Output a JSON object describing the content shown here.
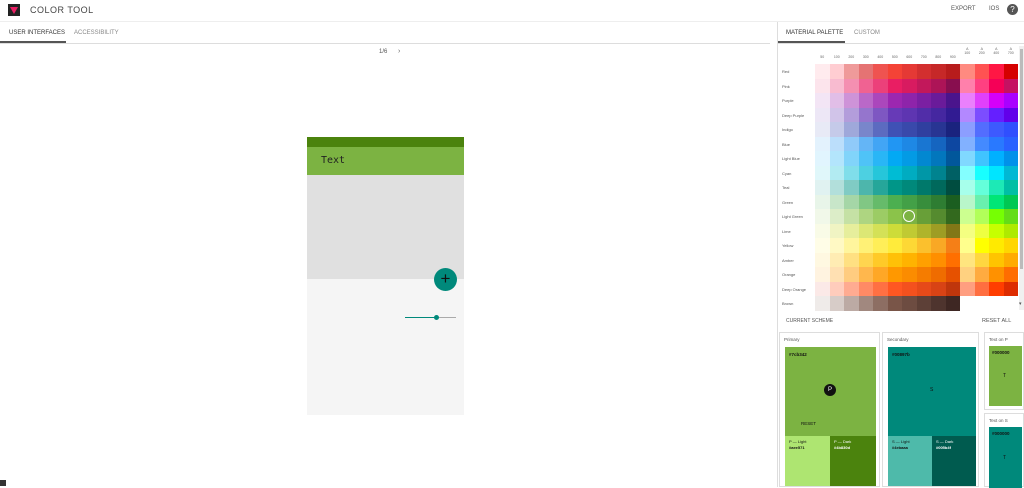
{
  "app": {
    "title": "COLOR  TOOL"
  },
  "top_actions": {
    "export": "EXPORT",
    "ios": "IOS",
    "help": "?"
  },
  "left_tabs": [
    {
      "label": "USER INTERFACES",
      "active": true
    },
    {
      "label": "ACCESSIBILITY",
      "active": false
    }
  ],
  "pager": {
    "position": "1/6",
    "next": "›"
  },
  "phone": {
    "appbar_text": "Text",
    "fab_symbol": "+",
    "slider_value": 0.6,
    "colors": {
      "primary_dark": "#4b830d",
      "primary": "#7cb342",
      "secondary": "#00897b"
    }
  },
  "right_tabs": [
    {
      "label": "MATERIAL PALETTE",
      "active": true
    },
    {
      "label": "CUSTOM",
      "active": false
    }
  ],
  "palette": {
    "shades": [
      "50",
      "100",
      "200",
      "300",
      "400",
      "500",
      "600",
      "700",
      "800",
      "900",
      "A\n100",
      "A\n200",
      "A\n400",
      "A\n700"
    ],
    "rows": [
      {
        "name": "Red",
        "colors": [
          "#ffebee",
          "#ffcdd2",
          "#ef9a9a",
          "#e57373",
          "#ef5350",
          "#f44336",
          "#e53935",
          "#d32f2f",
          "#c62828",
          "#b71c1c",
          "#ff8a80",
          "#ff5252",
          "#ff1744",
          "#d50000"
        ]
      },
      {
        "name": "Pink",
        "colors": [
          "#fce4ec",
          "#f8bbd0",
          "#f48fb1",
          "#f06292",
          "#ec407a",
          "#e91e63",
          "#d81b60",
          "#c2185b",
          "#ad1457",
          "#880e4f",
          "#ff80ab",
          "#ff4081",
          "#f50057",
          "#c51162"
        ]
      },
      {
        "name": "Purple",
        "colors": [
          "#f3e5f5",
          "#e1bee7",
          "#ce93d8",
          "#ba68c8",
          "#ab47bc",
          "#9c27b0",
          "#8e24aa",
          "#7b1fa2",
          "#6a1b9a",
          "#4a148c",
          "#ea80fc",
          "#e040fb",
          "#d500f9",
          "#aa00ff"
        ]
      },
      {
        "name": "Deep Purple",
        "colors": [
          "#ede7f6",
          "#d1c4e9",
          "#b39ddb",
          "#9575cd",
          "#7e57c2",
          "#673ab7",
          "#5e35b1",
          "#512da8",
          "#4527a0",
          "#311b92",
          "#b388ff",
          "#7c4dff",
          "#651fff",
          "#6200ea"
        ]
      },
      {
        "name": "Indigo",
        "colors": [
          "#e8eaf6",
          "#c5cae9",
          "#9fa8da",
          "#7986cb",
          "#5c6bc0",
          "#3f51b5",
          "#3949ab",
          "#303f9f",
          "#283593",
          "#1a237e",
          "#8c9eff",
          "#536dfe",
          "#3d5afe",
          "#304ffe"
        ]
      },
      {
        "name": "Blue",
        "colors": [
          "#e3f2fd",
          "#bbdefb",
          "#90caf9",
          "#64b5f6",
          "#42a5f5",
          "#2196f3",
          "#1e88e5",
          "#1976d2",
          "#1565c0",
          "#0d47a1",
          "#82b1ff",
          "#448aff",
          "#2979ff",
          "#2962ff"
        ]
      },
      {
        "name": "Light Blue",
        "colors": [
          "#e1f5fe",
          "#b3e5fc",
          "#81d4fa",
          "#4fc3f7",
          "#29b6f6",
          "#03a9f4",
          "#039be5",
          "#0288d1",
          "#0277bd",
          "#01579b",
          "#80d8ff",
          "#40c4ff",
          "#00b0ff",
          "#0091ea"
        ]
      },
      {
        "name": "Cyan",
        "colors": [
          "#e0f7fa",
          "#b2ebf2",
          "#80deea",
          "#4dd0e1",
          "#26c6da",
          "#00bcd4",
          "#00acc1",
          "#0097a7",
          "#00838f",
          "#006064",
          "#84ffff",
          "#18ffff",
          "#00e5ff",
          "#00b8d4"
        ]
      },
      {
        "name": "Teal",
        "colors": [
          "#e0f2f1",
          "#b2dfdb",
          "#80cbc4",
          "#4db6ac",
          "#26a69a",
          "#009688",
          "#00897b",
          "#00796b",
          "#00695c",
          "#004d40",
          "#a7ffeb",
          "#64ffda",
          "#1de9b6",
          "#00bfa5"
        ]
      },
      {
        "name": "Green",
        "colors": [
          "#e8f5e9",
          "#c8e6c9",
          "#a5d6a7",
          "#81c784",
          "#66bb6a",
          "#4caf50",
          "#43a047",
          "#388e3c",
          "#2e7d32",
          "#1b5e20",
          "#b9f6ca",
          "#69f0ae",
          "#00e676",
          "#00c853"
        ]
      },
      {
        "name": "Light Green",
        "colors": [
          "#f1f8e9",
          "#dcedc8",
          "#c5e1a5",
          "#aed581",
          "#9ccc65",
          "#8bc34a",
          "#7cb342",
          "#689f38",
          "#558b2f",
          "#33691e",
          "#ccff90",
          "#b2ff59",
          "#76ff03",
          "#64dd17"
        ]
      },
      {
        "name": "Lime",
        "colors": [
          "#f9fbe7",
          "#f0f4c3",
          "#e6ee9c",
          "#dce775",
          "#d4e157",
          "#cddc39",
          "#c0ca33",
          "#afb42b",
          "#9e9d24",
          "#827717",
          "#f4ff81",
          "#eeff41",
          "#c6ff00",
          "#aeea00"
        ]
      },
      {
        "name": "Yellow",
        "colors": [
          "#fffde7",
          "#fff9c4",
          "#fff59d",
          "#fff176",
          "#ffee58",
          "#ffeb3b",
          "#fdd835",
          "#fbc02d",
          "#f9a825",
          "#f57f17",
          "#ffff8d",
          "#ffff00",
          "#ffea00",
          "#ffd600"
        ]
      },
      {
        "name": "Amber",
        "colors": [
          "#fff8e1",
          "#ffecb3",
          "#ffe082",
          "#ffd54f",
          "#ffca28",
          "#ffc107",
          "#ffb300",
          "#ffa000",
          "#ff8f00",
          "#ff6f00",
          "#ffe57f",
          "#ffd740",
          "#ffc400",
          "#ffab00"
        ]
      },
      {
        "name": "Orange",
        "colors": [
          "#fff3e0",
          "#ffe0b2",
          "#ffcc80",
          "#ffb74d",
          "#ffa726",
          "#ff9800",
          "#fb8c00",
          "#f57c00",
          "#ef6c00",
          "#e65100",
          "#ffd180",
          "#ffab40",
          "#ff9100",
          "#ff6d00"
        ]
      },
      {
        "name": "Deep Orange",
        "colors": [
          "#fbe9e7",
          "#ffccbc",
          "#ffab91",
          "#ff8a65",
          "#ff7043",
          "#ff5722",
          "#f4511e",
          "#e64a19",
          "#d84315",
          "#bf360c",
          "#ff9e80",
          "#ff6e40",
          "#ff3d00",
          "#dd2c00"
        ]
      },
      {
        "name": "Brown",
        "colors": [
          "#efebe9",
          "#d7ccc8",
          "#bcaaa4",
          "#a1887f",
          "#8d6e63",
          "#795548",
          "#6d4c41",
          "#5d4037",
          "#4e342e",
          "#3e2723",
          "",
          "",
          "",
          ""
        ]
      }
    ]
  },
  "scheme": {
    "title": "CURRENT SCHEME",
    "reset_all": "RESET ALL",
    "primary": {
      "label": "Primary",
      "hex": "#7cb342",
      "letter": "P",
      "reset": "RESET",
      "light_label": "P — Light",
      "light_hex": "#aee571",
      "dark_label": "P — Dark",
      "dark_hex": "#4b830d",
      "colors": {
        "main": "#7cb342",
        "light": "#aee571",
        "dark": "#4b830d"
      }
    },
    "secondary": {
      "label": "Secondary",
      "hex": "#00897b",
      "letter": "S",
      "light_label": "S — Light",
      "light_hex": "#4ebaaa",
      "dark_label": "S — Dark",
      "dark_hex": "#005b4f",
      "colors": {
        "main": "#00897b",
        "light": "#4ebaaa",
        "dark": "#005b4f"
      }
    },
    "text_on_p": {
      "label": "Text on P",
      "hex": "#000000",
      "letter": "T"
    },
    "text_on_s": {
      "label": "Text on S",
      "hex": "#000000",
      "letter": "T"
    }
  }
}
